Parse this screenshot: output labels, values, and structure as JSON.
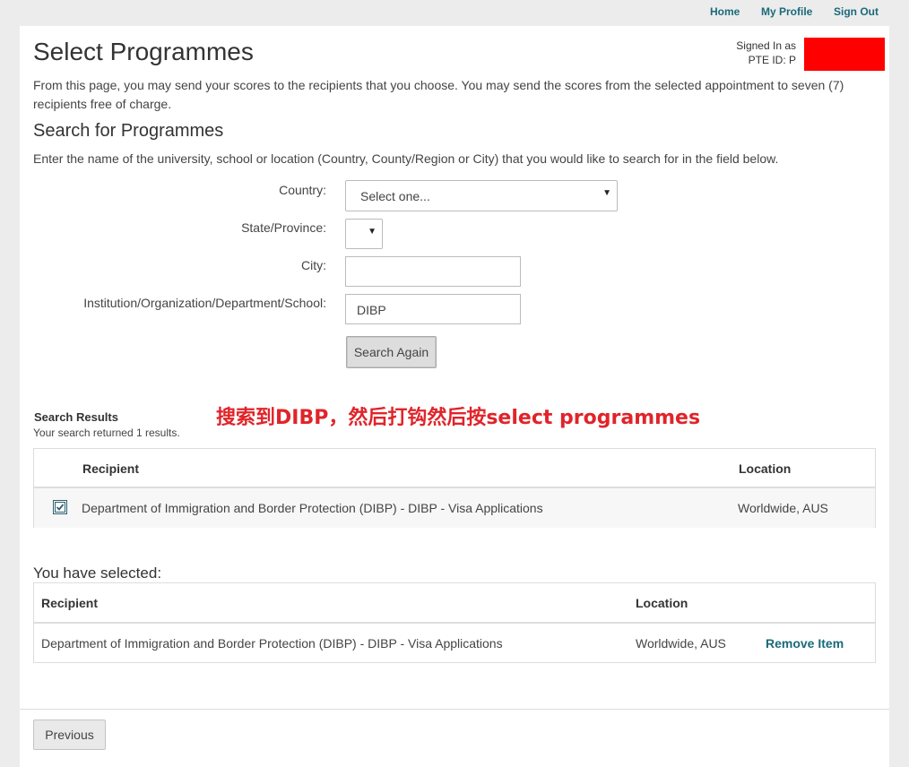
{
  "nav": {
    "home": "Home",
    "my_profile": "My Profile",
    "sign_out": "Sign Out"
  },
  "header": {
    "title": "Select Programmes",
    "signed_in_label": "Signed In as",
    "pte_id_label": "PTE ID: P"
  },
  "intro_text": "From this page, you may send your scores to the recipients that you choose. You may send the scores from the selected appointment to seven (7) recipients free of charge.",
  "search": {
    "heading": "Search for Programmes",
    "hint": "Enter the name of the university, school or location (Country, County/Region or City) that you would like to search for in the field below.",
    "country_label": "Country:",
    "country_value": "Select one...",
    "state_label": "State/Province:",
    "state_value": "",
    "city_label": "City:",
    "city_value": "",
    "institution_label": "Institution/Organization/Department/School:",
    "institution_value": "DIBP",
    "search_button": "Search Again"
  },
  "annotation_text": "搜索到DIBP，然后打钩然后按select programmes",
  "results": {
    "title": "Search Results",
    "subtitle": "Your search returned 1 results.",
    "columns": [
      "Recipient",
      "Location"
    ],
    "rows": [
      {
        "checked": true,
        "recipient": "Department of Immigration and Border Protection (DIBP) - DIBP - Visa Applications",
        "location": "Worldwide, AUS"
      }
    ]
  },
  "selected": {
    "title": "You have selected:",
    "columns": [
      "Recipient",
      "Location"
    ],
    "rows": [
      {
        "recipient": "Department of Immigration and Border Protection (DIBP) - DIBP - Visa Applications",
        "location": "Worldwide, AUS",
        "action": "Remove Item"
      }
    ]
  },
  "footer": {
    "previous_button": "Previous"
  },
  "colors": {
    "link": "#1a6a7a",
    "annotation": "#e0242a",
    "redaction": "#ff0000"
  }
}
